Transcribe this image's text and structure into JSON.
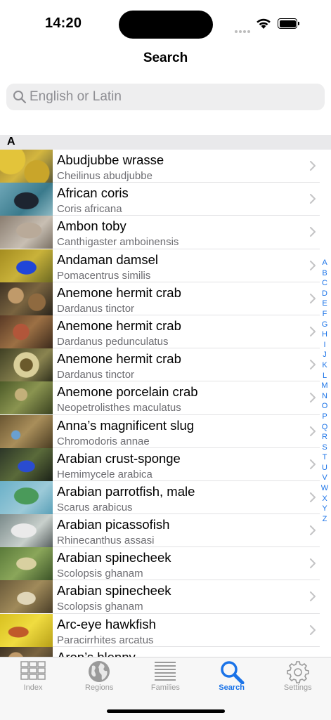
{
  "status": {
    "time": "14:20"
  },
  "nav": {
    "title": "Search"
  },
  "search": {
    "placeholder": "English or Latin",
    "value": ""
  },
  "section": {
    "letter": "A"
  },
  "rows": [
    {
      "title": "Abudjubbe wrasse",
      "subtitle": "Cheilinus abudjubbe",
      "thumb": "yellow-coral"
    },
    {
      "title": "African coris",
      "subtitle": "Coris africana",
      "thumb": "dark-fish"
    },
    {
      "title": "Ambon toby",
      "subtitle": "Canthigaster amboinensis",
      "thumb": "sandy-fish"
    },
    {
      "title": "Andaman damsel",
      "subtitle": "Pomacentrus similis",
      "thumb": "blue-fish"
    },
    {
      "title": "Anemone hermit crab",
      "subtitle": "Dardanus tinctor",
      "thumb": "reef"
    },
    {
      "title": "Anemone hermit crab",
      "subtitle": "Dardanus pedunculatus",
      "thumb": "reef-red"
    },
    {
      "title": "Anemone hermit crab",
      "subtitle": "Dardanus tinctor",
      "thumb": "sandy-crab"
    },
    {
      "title": "Anemone porcelain crab",
      "subtitle": "Neopetrolisthes maculatus",
      "thumb": "green-reef"
    },
    {
      "title": "Anna’s magnificent slug",
      "subtitle": "Chromodoris annae",
      "thumb": "brown-reef"
    },
    {
      "title": "Arabian crust-sponge",
      "subtitle": "Hemimycele arabica",
      "thumb": "blue-fish-dark"
    },
    {
      "title": "Arabian parrotfish, male",
      "subtitle": "Scarus arabicus",
      "thumb": "green-fish"
    },
    {
      "title": "Arabian picassofish",
      "subtitle": "Rhinecanthus assasi",
      "thumb": "white-fish"
    },
    {
      "title": "Arabian spinecheek",
      "subtitle": "Scolopsis ghanam",
      "thumb": "green-striped"
    },
    {
      "title": "Arabian spinecheek",
      "subtitle": "Scolopsis ghanam",
      "thumb": "brown-striped"
    },
    {
      "title": "Arc-eye hawkfish",
      "subtitle": "Paracirrhites arcatus",
      "thumb": "yellow-fish"
    },
    {
      "title": "Aron’s blenny",
      "subtitle": "",
      "thumb": "reef"
    }
  ],
  "index_letters": [
    "A",
    "B",
    "C",
    "D",
    "E",
    "F",
    "G",
    "H",
    "I",
    "J",
    "K",
    "L",
    "M",
    "N",
    "O",
    "P",
    "Q",
    "R",
    "S",
    "T",
    "U",
    "V",
    "W",
    "X",
    "Y",
    "Z"
  ],
  "tabs": [
    {
      "label": "Index",
      "icon": "grid-icon",
      "active": false
    },
    {
      "label": "Regions",
      "icon": "globe-icon",
      "active": false
    },
    {
      "label": "Families",
      "icon": "list-lines-icon",
      "active": false
    },
    {
      "label": "Search",
      "icon": "search-icon",
      "active": true
    },
    {
      "label": "Settings",
      "icon": "gear-icon",
      "active": false
    }
  ],
  "colors": {
    "accent": "#1a73e8",
    "inactive": "#9a9a9a"
  }
}
